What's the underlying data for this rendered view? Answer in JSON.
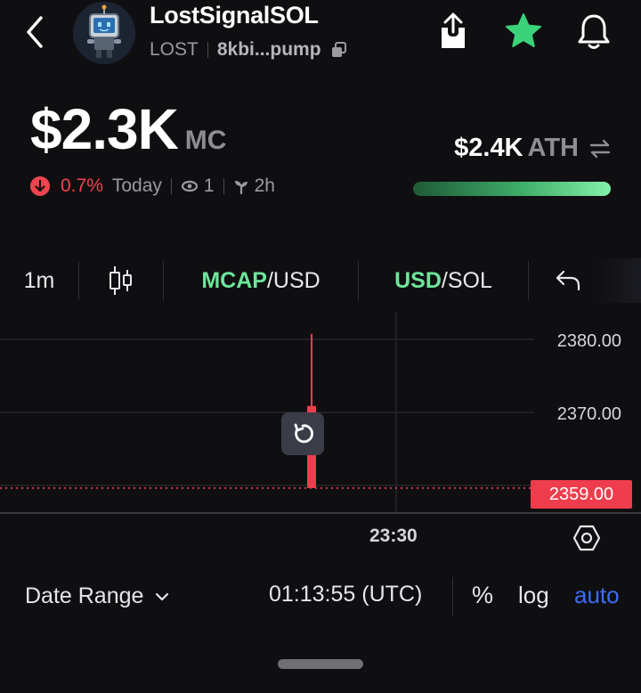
{
  "header": {
    "token_name": "LostSignalSOL",
    "ticker": "LOST",
    "address": "8kbi...pump",
    "icons": {
      "back": "chevron-left-icon",
      "copy": "copy-icon",
      "share": "share-icon",
      "favorite": "star-icon",
      "alerts": "bell-icon"
    },
    "favorite_color": "#3ad27a"
  },
  "market": {
    "market_cap": "$2.3K",
    "market_cap_unit": "MC",
    "change_pct": "0.7%",
    "change_direction": "down",
    "change_period": "Today",
    "holders": "1",
    "age": "2h",
    "ath_value": "$2.4K",
    "ath_label": "ATH",
    "ath_progress": 0.96,
    "down_color": "#f0454f",
    "up_color": "#6ee59a"
  },
  "toolbar": {
    "interval": "1m",
    "chart_type_icon": "candlestick-icon",
    "metric_active": "MCAP",
    "metric_rest": "/USD",
    "currency_active": "USD",
    "currency_rest": "/SOL",
    "undo_icon": "undo-icon"
  },
  "chart": {
    "y_labels": [
      "2380.00",
      "2370.00"
    ],
    "last_price": "2359.00",
    "x_label": "23:30",
    "candle": {
      "open": 2370.5,
      "close": 2359.0,
      "high": 2380.6,
      "low": 2359.0
    },
    "y_range": [
      2355.5,
      2383.7
    ],
    "candle_color": "#f03d4d"
  },
  "bottom_bar": {
    "date_range_label": "Date Range",
    "clock": "01:13:55 (UTC)",
    "percent_label": "%",
    "log_label": "log",
    "auto_label": "auto",
    "auto_color": "#3d6cf2"
  }
}
